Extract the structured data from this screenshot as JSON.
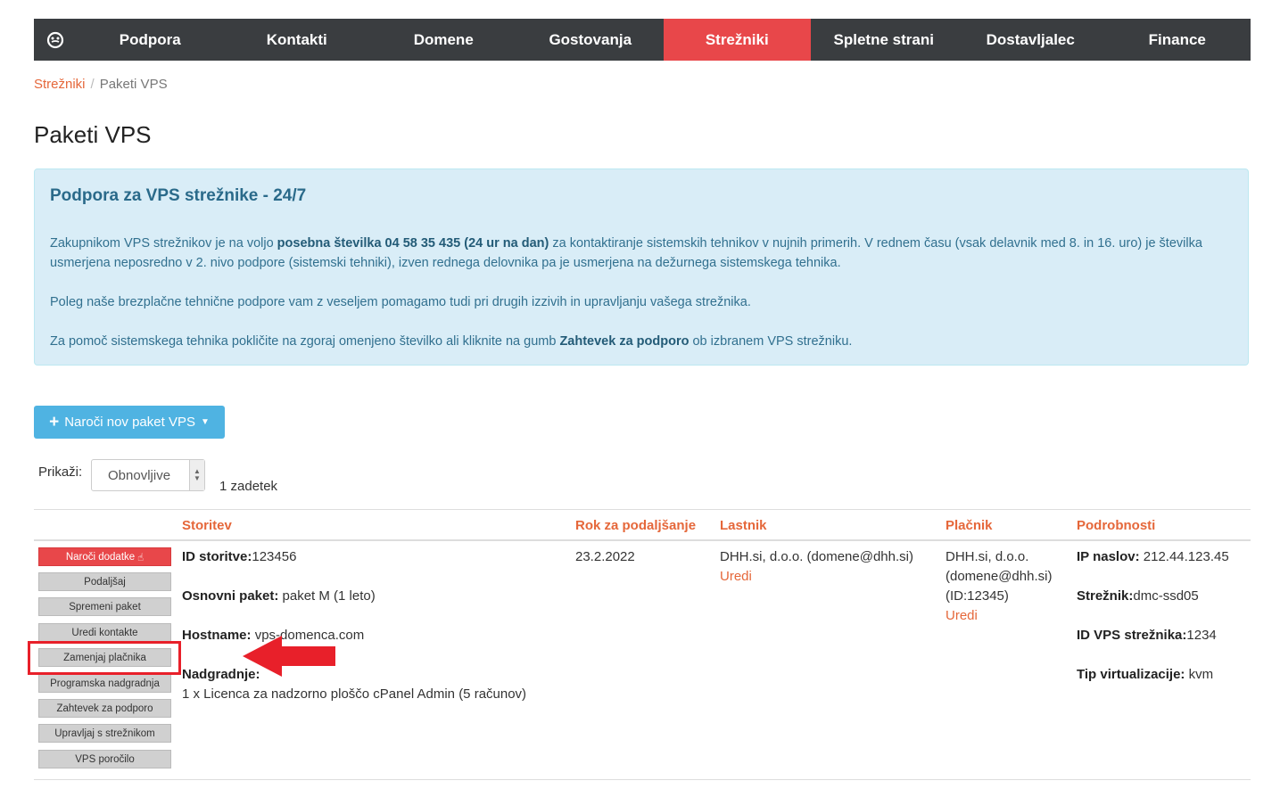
{
  "nav": {
    "items": [
      {
        "label": "Podpora"
      },
      {
        "label": "Kontakti"
      },
      {
        "label": "Domene"
      },
      {
        "label": "Gostovanja"
      },
      {
        "label": "Strežniki",
        "active": true
      },
      {
        "label": "Spletne strani"
      },
      {
        "label": "Dostavljalec"
      },
      {
        "label": "Finance"
      }
    ]
  },
  "breadcrumb": {
    "parent": "Strežniki",
    "separator": "/",
    "current": "Paketi VPS"
  },
  "page_title": "Paketi VPS",
  "alert": {
    "title": "Podpora za VPS strežnike - 24/7",
    "p1_a": "Zakupnikom VPS strežnikov je na voljo ",
    "p1_bold": "posebna številka 04 58 35 435 (24 ur na dan)",
    "p1_b": " za kontaktiranje sistemskih tehnikov v nujnih primerih. V rednem času (vsak delavnik med 8. in 16. uro) je številka usmerjena neposredno v 2. nivo podpore (sistemski tehniki), izven rednega delovnika pa je usmerjena na dežurnega sistemskega tehnika.",
    "p2": "Poleg naše brezplačne tehnične podpore vam z veseljem pomagamo tudi pri drugih izzivih in upravljanju vašega strežnika.",
    "p3_a": "Za pomoč sistemskega tehnika pokličite na zgoraj omenjeno številko ali kliknite na gumb ",
    "p3_bold": "Zahtevek za podporo",
    "p3_b": " ob izbranem VPS strežniku."
  },
  "order_button": {
    "label": "Naroči nov paket VPS"
  },
  "filter": {
    "label": "Prikaži:",
    "selected": "Obnovljive",
    "count": "1 zadetek"
  },
  "table": {
    "headers": {
      "service": "Storitev",
      "renewal": "Rok za podaljšanje",
      "owner": "Lastnik",
      "payer": "Plačnik",
      "details": "Podrobnosti"
    },
    "actions": [
      "Naroči dodatke",
      "Podaljšaj",
      "Spremeni paket",
      "Uredi kontakte",
      "Zamenjaj plačnika",
      "Programska nadgradnja",
      "Zahtevek za podporo",
      "Upravljaj s strežnikom",
      "VPS poročilo"
    ],
    "row": {
      "service_id_label": "ID storitve:",
      "service_id": "123456",
      "base_label": "Osnovni paket:",
      "base_value": "paket M (1 leto)",
      "hostname_label": "Hostname:",
      "hostname_value": "vps-domenca.com",
      "upgrades_label": "Nadgradnje:",
      "upgrades_value": "1 x Licenca za nadzorno ploščo cPanel Admin (5 računov)",
      "renewal_date": "23.2.2022",
      "owner": "DHH.si, d.o.o. (domene@dhh.si)",
      "owner_edit": "Uredi",
      "payer_line1": "DHH.si, d.o.o.",
      "payer_line2": "(domene@dhh.si)",
      "payer_line3": "(ID:12345)",
      "payer_edit": "Uredi",
      "ip_label": "IP naslov:",
      "ip_value": "212.44.123.45",
      "server_label": "Strežnik:",
      "server_value": "dmc-ssd05",
      "vps_id_label": "ID VPS strežnika:",
      "vps_id_value": "1234",
      "virt_label": "Tip virtualizacije:",
      "virt_value": "kvm"
    }
  },
  "colors": {
    "nav_bg": "#3a3d40",
    "nav_active": "#e8474a",
    "accent": "#e5673a",
    "alert_bg": "#d9edf7",
    "primary_btn": "#4fb3e2",
    "annotation": "#e8202a"
  }
}
